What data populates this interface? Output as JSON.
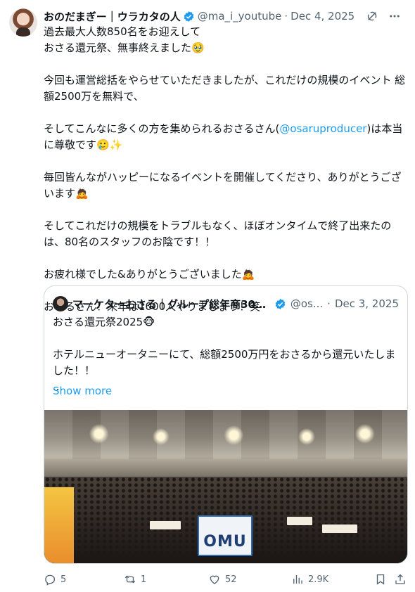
{
  "author": {
    "name": "おのだまぎー｜ウラカタの人",
    "handle": "@ma_i_youtube",
    "separator": "·",
    "date": "Dec 4, 2025"
  },
  "tweet": {
    "p1_l1": "過去最大人数850名をお迎えして",
    "p1_l2": "おさる還元祭、無事終えました🥹",
    "p2": "今回も運営総括をやらせていただきましたが、これだけの規模のイベント 総額2500万を無料で、",
    "p3_pre": "そしてこんなに多くの方を集められるおさるさん(",
    "p3_mention": "@osaruproducer",
    "p3_post": ")は本当に尊敬です🥲✨",
    "p4": "毎回皆んながハッピーになるイベントを開催してくださり、ありがとうございます🙇",
    "p5": "そしてこれだけの規模をトラブルもなく、ほぼオンタイムで終了出来たのは、80名のスタッフのお陰です！！",
    "p6": "お疲れ様でした&ありがとうございました🙇",
    "p7": "おさるさん！来年は1000人やりましょう！笑"
  },
  "quote": {
    "name": "マーケターおさる｜グループ総年商30億...",
    "handle": "@os...",
    "separator": "·",
    "date": "Dec 3, 2025",
    "text_l1": "おさる還元祭2025🐵",
    "text_l2": "ホテルニューオータニーにて、総額2500万円をおさるから還元いたしました！！",
    "text_l3": "...",
    "show_more": "Show more",
    "photo_sign": "OMU"
  },
  "actions": {
    "replies": "5",
    "reposts": "1",
    "likes": "52",
    "views": "2.9K"
  },
  "colors": {
    "link": "#1d9bf0",
    "muted": "#536471",
    "border": "#cfd9de",
    "verified": "#1d9bf0"
  }
}
